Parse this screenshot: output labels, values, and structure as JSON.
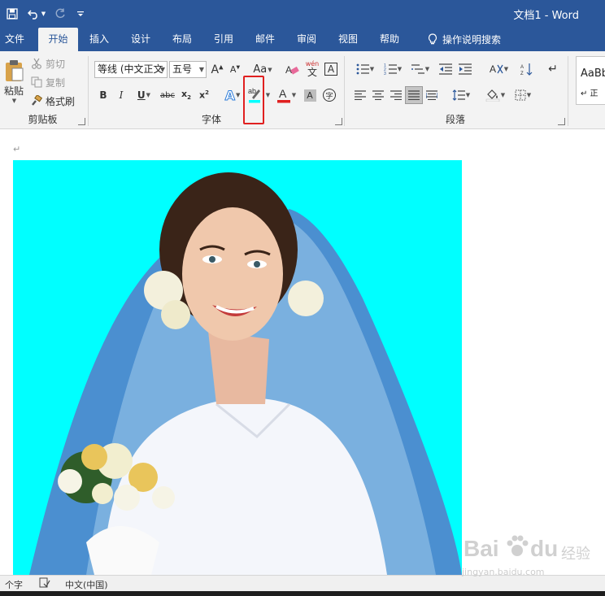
{
  "window": {
    "title": "文档1 - Word"
  },
  "qat": {
    "icons": [
      "save-icon",
      "undo-icon",
      "redo-icon",
      "customize-icon"
    ]
  },
  "tabs": [
    "文件",
    "开始",
    "插入",
    "设计",
    "布局",
    "引用",
    "邮件",
    "审阅",
    "视图",
    "帮助"
  ],
  "tell_me": {
    "label": "操作说明搜索"
  },
  "clipboard": {
    "paste": "粘贴",
    "cut": "剪切",
    "copy": "复制",
    "format_painter": "格式刷",
    "group": "剪贴板"
  },
  "font": {
    "name": "等线 (中文正文",
    "size": "五号",
    "group": "字体",
    "case_btn": "Aa",
    "wen_btn": "wén",
    "wen_sub": "文",
    "border_a": "A",
    "circle": "字"
  },
  "paragraph": {
    "group": "段落"
  },
  "styles": {
    "preview": "AaBb",
    "sub": "↵ 正"
  },
  "document": {
    "para_mark": "↵"
  },
  "status": {
    "words": "个字",
    "language": "中文(中国)"
  },
  "watermark": {
    "brand": "Bai",
    "du": "du",
    "jingyan": "经验",
    "url": "jingyan.baidu.com"
  },
  "colors": {
    "accent": "#2b579a",
    "highlight": "#00ffff",
    "font_color": "#e02020",
    "callout": "#e02020"
  }
}
